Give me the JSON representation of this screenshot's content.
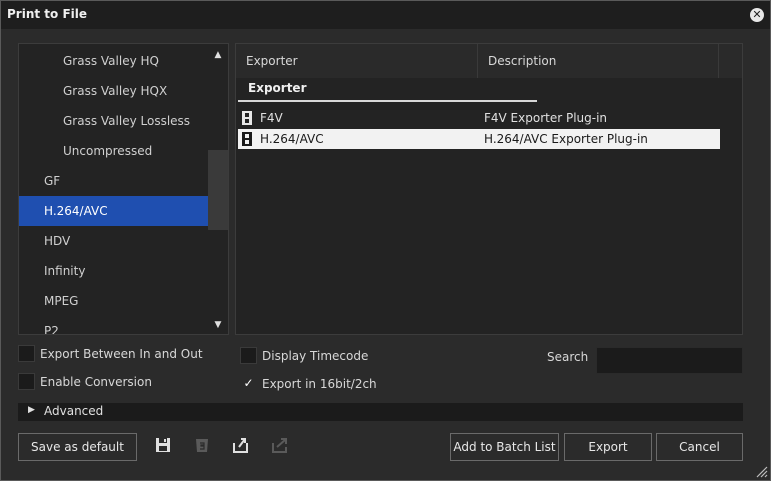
{
  "window": {
    "title": "Print to File"
  },
  "format_list": {
    "items": [
      {
        "label": "Grass Valley HQ",
        "indent": true,
        "selected": false
      },
      {
        "label": "Grass Valley HQX",
        "indent": true,
        "selected": false
      },
      {
        "label": "Grass Valley Lossless",
        "indent": true,
        "selected": false
      },
      {
        "label": "Uncompressed",
        "indent": true,
        "selected": false
      },
      {
        "label": "GF",
        "indent": false,
        "selected": false
      },
      {
        "label": "H.264/AVC",
        "indent": false,
        "selected": true
      },
      {
        "label": "HDV",
        "indent": false,
        "selected": false
      },
      {
        "label": "Infinity",
        "indent": false,
        "selected": false
      },
      {
        "label": "MPEG",
        "indent": false,
        "selected": false
      },
      {
        "label": "P2",
        "indent": false,
        "selected": false
      }
    ]
  },
  "exporter_grid": {
    "columns": [
      "Exporter",
      "Description"
    ],
    "group_label": "Exporter",
    "rows": [
      {
        "exporter": "F4V",
        "description": "F4V Exporter Plug-in",
        "selected": false,
        "icon": "film-strip-icon"
      },
      {
        "exporter": "H.264/AVC",
        "description": "H.264/AVC Exporter Plug-in",
        "selected": true,
        "icon": "film-strip-icon"
      }
    ]
  },
  "options": {
    "export_between_in_out": {
      "label": "Export Between In and Out",
      "checked": false
    },
    "enable_conversion": {
      "label": "Enable Conversion",
      "checked": false
    },
    "display_timecode": {
      "label": "Display Timecode",
      "checked": false
    },
    "export_16bit_2ch": {
      "label": "Export in 16bit/2ch",
      "checked": true
    }
  },
  "search": {
    "label": "Search",
    "value": ""
  },
  "advanced": {
    "label": "Advanced"
  },
  "buttons": {
    "save_default": "Save as default",
    "add_batch": "Add to Batch List",
    "export": "Export",
    "cancel": "Cancel"
  },
  "toolbar_icons": [
    "save-icon",
    "delete-preset-icon",
    "import-preset-icon",
    "export-preset-icon"
  ],
  "colors": {
    "selection": "#1f4fb0",
    "background": "#2b2b2b",
    "titlebar": "#1e1e1e"
  }
}
